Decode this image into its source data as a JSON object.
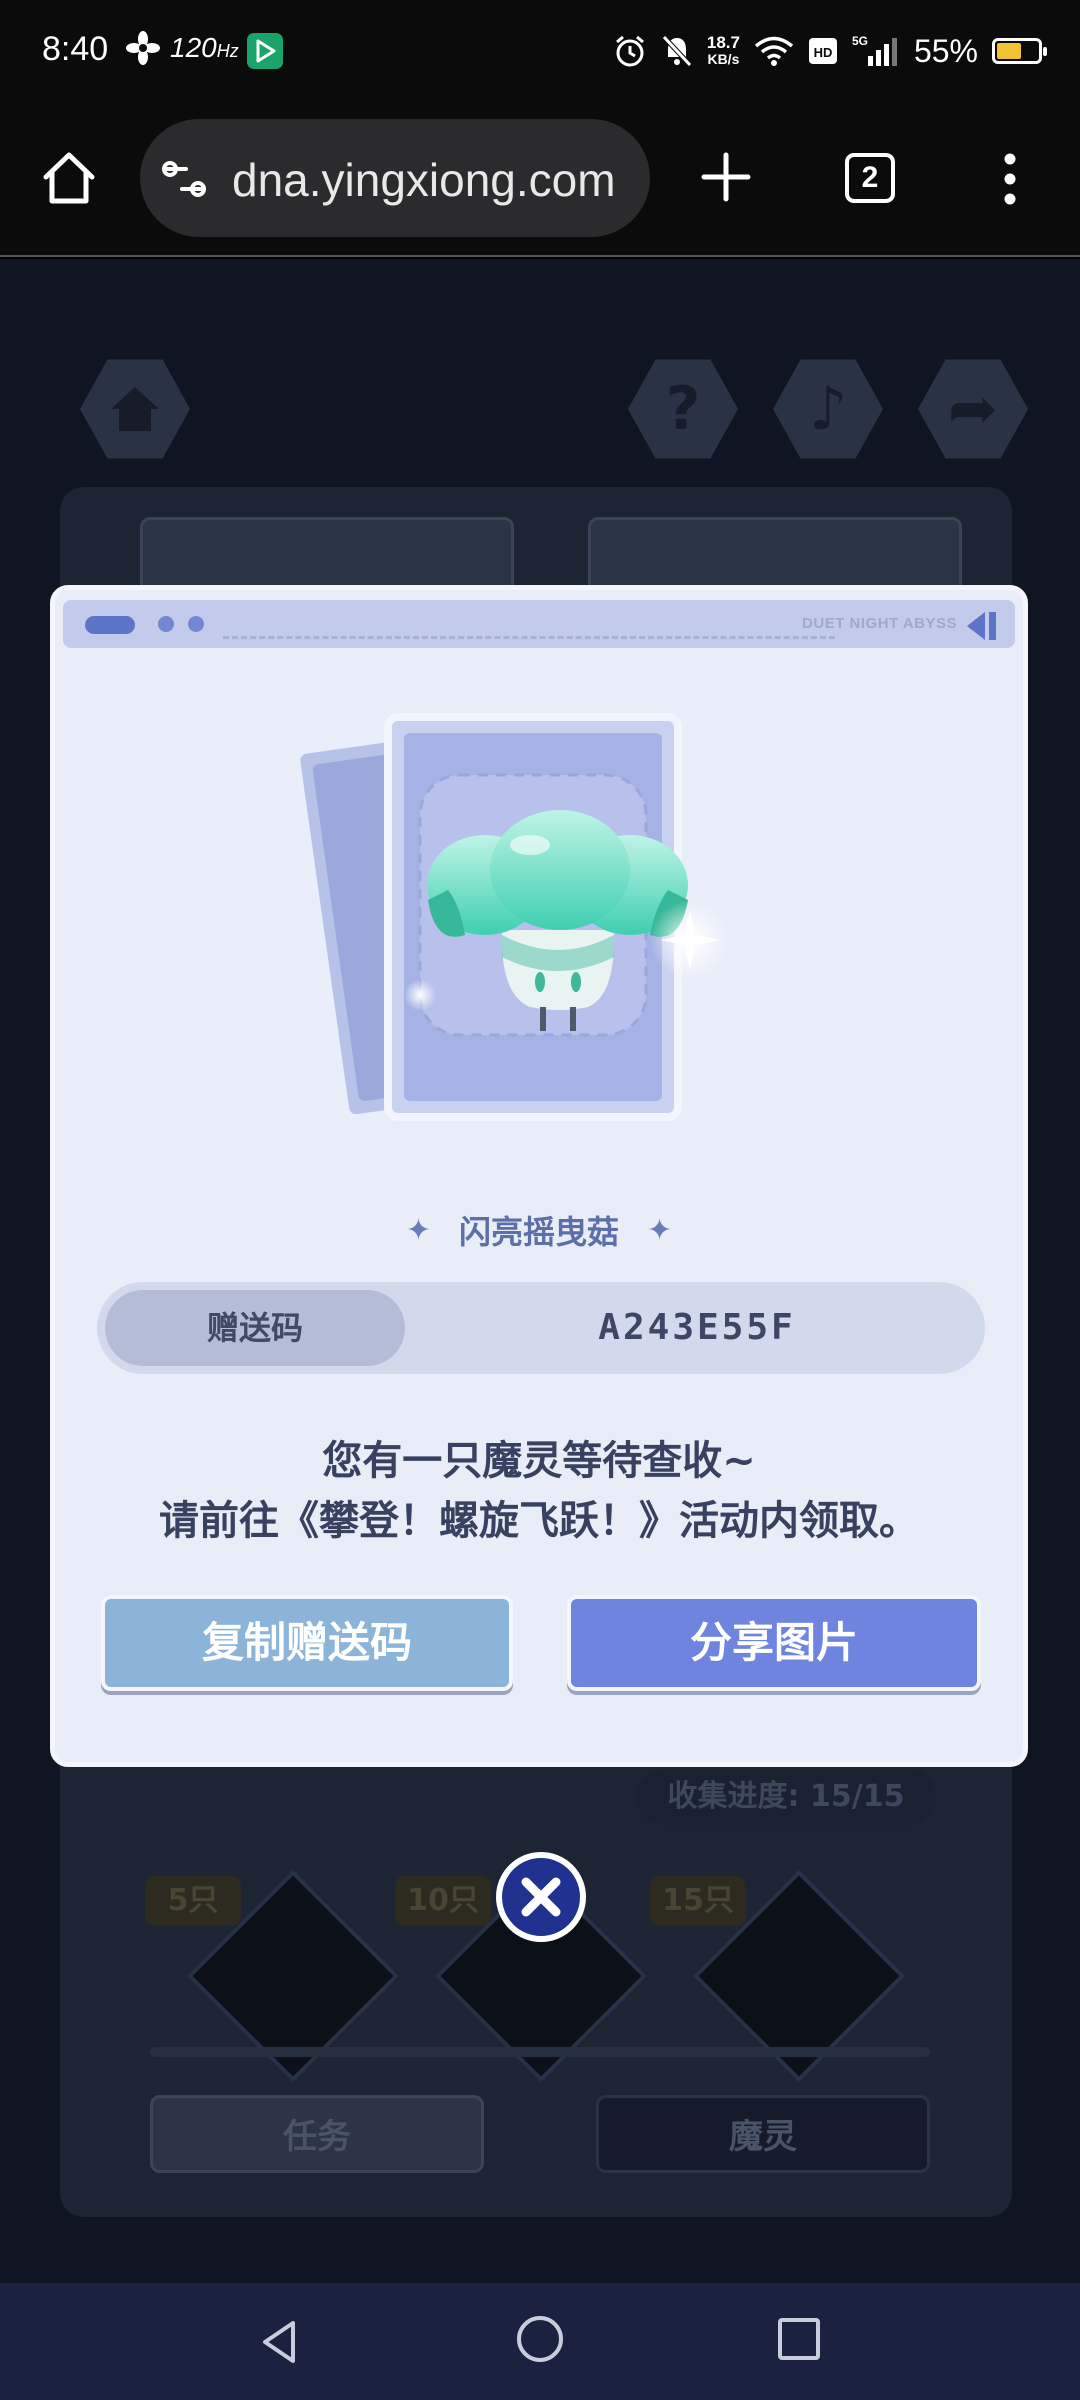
{
  "status_bar": {
    "time": "8:40",
    "refresh_rate": "120",
    "net_speed_value": "18.7",
    "net_speed_unit": "KB/s",
    "network": "5G",
    "battery": "55%",
    "battery_level": 0.55,
    "icons": [
      "fan-icon",
      "play-store-icon",
      "alarm-icon",
      "silent-bell-icon",
      "wifi-icon",
      "hd-icon",
      "signal-icon",
      "battery-charging-icon"
    ]
  },
  "browser": {
    "url": "dna.yingxiong.com",
    "tab_count": "2",
    "icons": [
      "home-icon",
      "site-settings-icon",
      "new-tab-plus-icon",
      "more-vert-icon"
    ]
  },
  "game_background": {
    "collection_progress": "收集进度: 15/15",
    "milestones": [
      "5只",
      "10只",
      "15只"
    ],
    "tab_tasks": "任务",
    "tab_spirits": "魔灵",
    "icons": [
      "home-icon",
      "help-icon",
      "music-icon",
      "share-icon"
    ]
  },
  "dialog": {
    "brand": "DUET NIGHT ABYSS",
    "item_name": "闪亮摇曳菇",
    "code_label": "赠送码",
    "code_value": "A243E55F",
    "message_line1": "您有一只魔灵等待查收~",
    "message_line2": "请前往《攀登！螺旋飞跃！》活动内领取。",
    "copy_button": "复制赠送码",
    "share_button": "分享图片",
    "colors": {
      "copy_button": "#8cb4d8",
      "share_button": "#6f84de",
      "panel": "#e8edf8"
    }
  },
  "nav_bar": {
    "icons": [
      "back-icon",
      "home-circle-icon",
      "recents-icon"
    ]
  }
}
